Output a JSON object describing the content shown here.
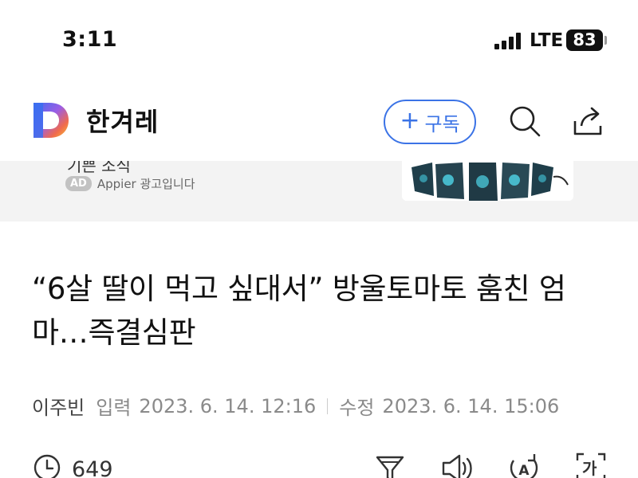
{
  "status_bar": {
    "time": "3:11",
    "network": "LTE",
    "battery": "83",
    "signal_bars": 4
  },
  "header": {
    "publisher": "한겨레",
    "subscribe_label": "구독",
    "subscribe_plus": "+",
    "icons": [
      "d-logo-icon",
      "search-icon",
      "share-icon"
    ],
    "accent_color": "#3b73e6"
  },
  "ad": {
    "cut_text": "기쁜 소식",
    "badge": "AD",
    "source": "Appier 광고입니다"
  },
  "article": {
    "headline": "“6살 딸이 먹고 싶대서” 방울토마토 훔친 엄마…즉결심판",
    "author": "이주빈",
    "published_label": "입력",
    "published": "2023. 6. 14. 12:16",
    "modified_label": "수정",
    "modified": "2023. 6. 14. 15:06",
    "views": "649",
    "tool_icons": [
      "clock-icon",
      "filter-icon",
      "speaker-icon",
      "translate-icon",
      "font-size-icon"
    ],
    "font_icon_label": "가"
  }
}
